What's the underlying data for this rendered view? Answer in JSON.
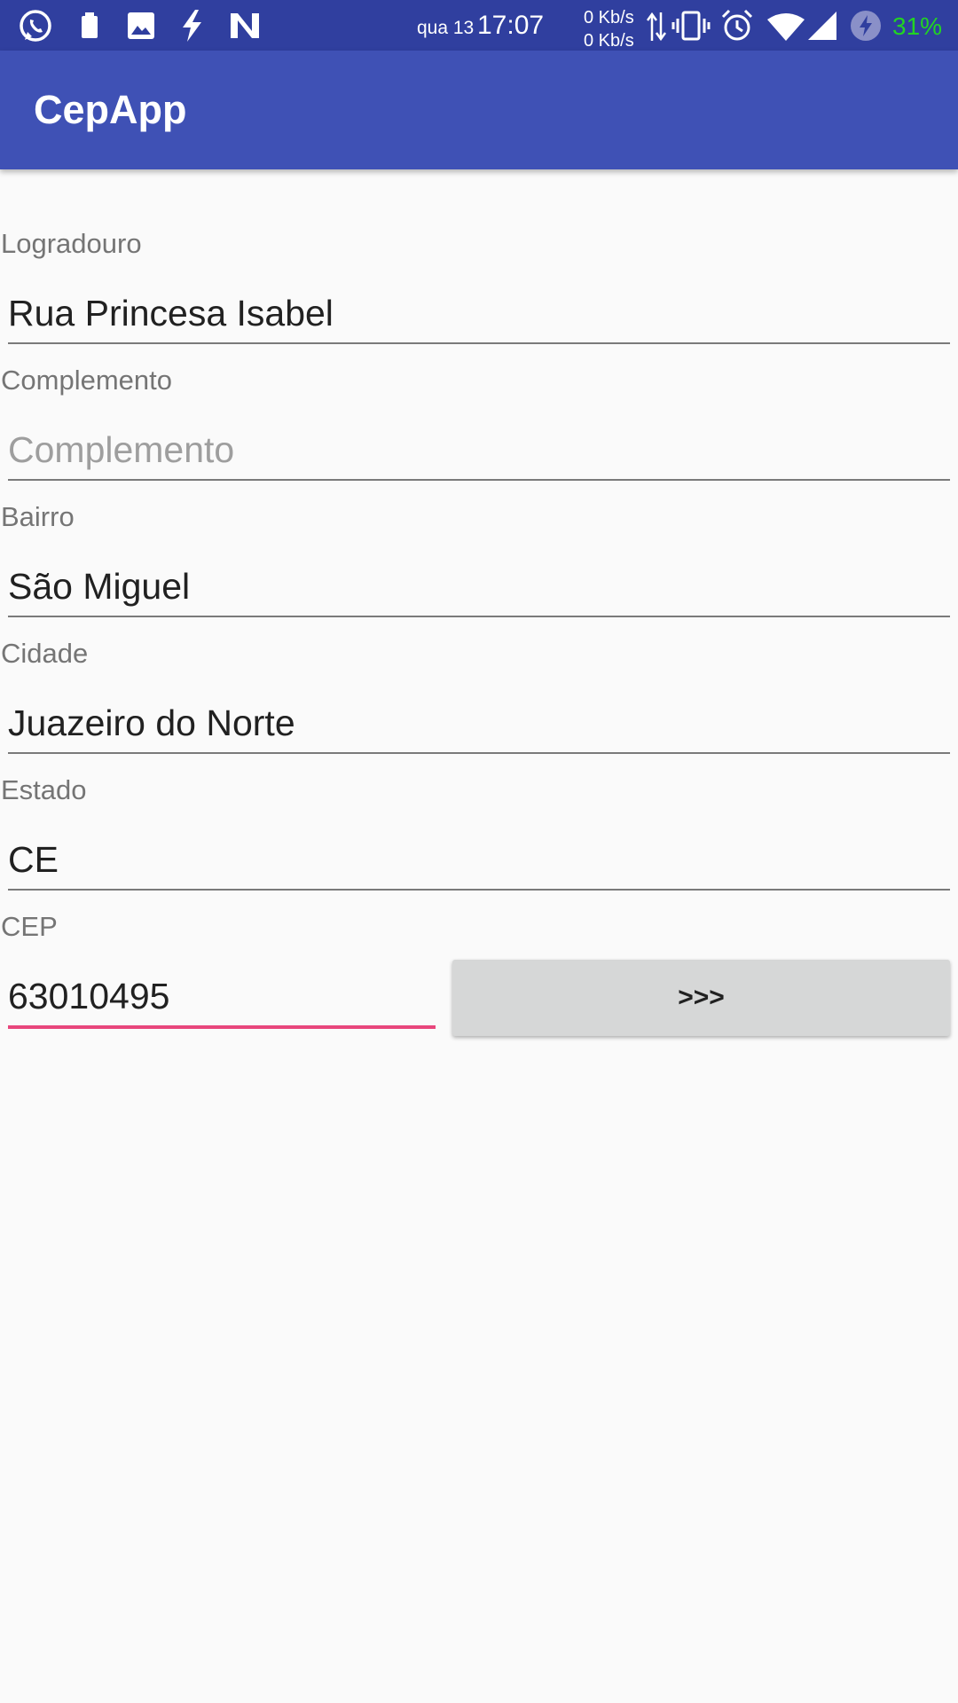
{
  "status_bar": {
    "date": "qua 13",
    "time": "17:07",
    "net_up": "0 Kb/s",
    "net_down": "0 Kb/s",
    "battery": "31%",
    "battery_color": "#22d422",
    "left_icons": [
      "whatsapp-icon",
      "sim-battery-icon",
      "gallery-icon",
      "flash-icon",
      "n-logo-icon"
    ],
    "right_icons": [
      "data-arrows-icon",
      "vibrate-icon",
      "alarm-icon",
      "wifi-icon",
      "signal-icon",
      "charging-icon"
    ]
  },
  "app_bar": {
    "title": "CepApp",
    "color": "#3f51b5"
  },
  "form": {
    "logradouro": {
      "label": "Logradouro",
      "value": "Rua Princesa Isabel",
      "placeholder": ""
    },
    "complemento": {
      "label": "Complemento",
      "value": "",
      "placeholder": "Complemento"
    },
    "bairro": {
      "label": "Bairro",
      "value": "São Miguel",
      "placeholder": ""
    },
    "cidade": {
      "label": "Cidade",
      "value": "Juazeiro do Norte",
      "placeholder": ""
    },
    "estado": {
      "label": "Estado",
      "value": "CE",
      "placeholder": ""
    },
    "cep": {
      "label": "CEP",
      "value": "63010495",
      "placeholder": ""
    },
    "search_button": "&gt;&gt;&gt;"
  },
  "colors": {
    "accent": "#e8467c",
    "status_bar": "#303f9f"
  }
}
